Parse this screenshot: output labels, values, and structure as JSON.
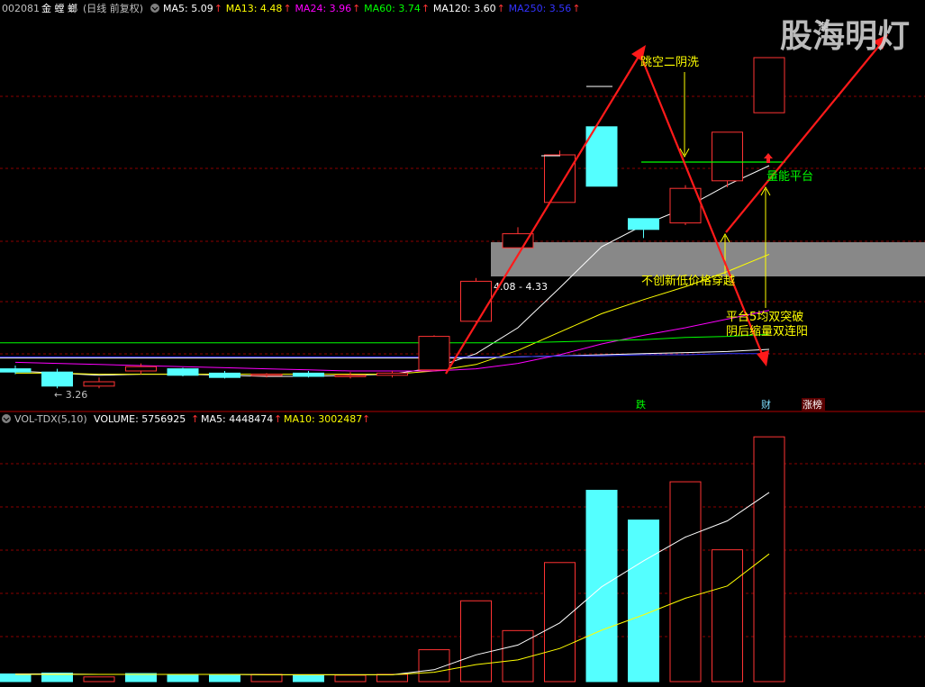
{
  "header": {
    "code": "002081",
    "name": "金 螳 螂",
    "period": "(日线 前复权)",
    "ma": [
      {
        "label": "MA5: 5.09",
        "color": "#ffffff"
      },
      {
        "label": "MA13: 4.48",
        "color": "#ffff00"
      },
      {
        "label": "MA24: 3.96",
        "color": "#ff00ff"
      },
      {
        "label": "MA60: 3.74",
        "color": "#00ff00"
      },
      {
        "label": "MA120: 3.60",
        "color": "#ffffff"
      },
      {
        "label": "MA250: 3.56",
        "color": "#3333ff"
      }
    ]
  },
  "vol_header": {
    "title": "VOL-TDX(5,10)",
    "volume": "VOLUME: 5756925",
    "ma5": "MA5: 4448474",
    "ma10": "MA10: 3002487"
  },
  "watermark": "股海明灯",
  "annotations": {
    "gap_wash": "跳空二阴洗",
    "volume_platform": "量能平台",
    "no_new_low": "不创新低价格穿越",
    "platform_break": "平台5均双突破",
    "shrink_double_yang": "阴后缩量双连阳",
    "price_low": "← 3.26",
    "band_range": "4.08 - 4.33",
    "tag_die": "跌",
    "tag_cai": "财",
    "tag_zhangbang": "涨榜",
    "top_label": "海"
  },
  "colors": {
    "background": "#000000",
    "up": "#ff3333",
    "down": "#54ffff",
    "grid": "#8b0000",
    "arrow": "#ff1a1a",
    "annotation": "#ffff00",
    "platform": "#00ff00"
  },
  "chart_data": [
    {
      "type": "candlestick",
      "title": "002081 金 螳 螂 (日线 前复权)",
      "ylim": [
        2.9,
        6.3
      ],
      "candles": [
        {
          "o": 3.42,
          "h": 3.45,
          "l": 3.37,
          "c": 3.39
        },
        {
          "o": 3.39,
          "h": 3.42,
          "l": 3.24,
          "c": 3.26
        },
        {
          "o": 3.26,
          "h": 3.34,
          "l": 3.24,
          "c": 3.3
        },
        {
          "o": 3.4,
          "h": 3.47,
          "l": 3.37,
          "c": 3.44
        },
        {
          "o": 3.42,
          "h": 3.43,
          "l": 3.35,
          "c": 3.36
        },
        {
          "o": 3.38,
          "h": 3.4,
          "l": 3.33,
          "c": 3.34
        },
        {
          "o": 3.36,
          "h": 3.38,
          "l": 3.34,
          "c": 3.37
        },
        {
          "o": 3.38,
          "h": 3.4,
          "l": 3.34,
          "c": 3.35
        },
        {
          "o": 3.35,
          "h": 3.39,
          "l": 3.33,
          "c": 3.36
        },
        {
          "o": 3.36,
          "h": 3.4,
          "l": 3.34,
          "c": 3.38
        },
        {
          "o": 3.41,
          "h": 3.73,
          "l": 3.4,
          "c": 3.72
        },
        {
          "o": 3.86,
          "h": 4.26,
          "l": 3.85,
          "c": 4.23
        },
        {
          "o": 4.54,
          "h": 4.73,
          "l": 4.54,
          "c": 4.67
        },
        {
          "o": 4.96,
          "h": 5.44,
          "l": 4.96,
          "c": 5.4
        },
        {
          "o": 5.66,
          "h": 5.66,
          "l": 5.11,
          "c": 5.11
        },
        {
          "o": 4.81,
          "h": 4.81,
          "l": 4.63,
          "c": 4.71
        },
        {
          "o": 4.77,
          "h": 5.12,
          "l": 4.75,
          "c": 5.09
        },
        {
          "o": 5.16,
          "h": 5.61,
          "l": 5.1,
          "c": 5.61
        },
        {
          "o": 5.79,
          "h": 6.3,
          "l": 5.79,
          "c": 6.3
        }
      ],
      "ma_series": [
        {
          "name": "MA5",
          "color": "#ffffff",
          "values": [
            3.4,
            3.38,
            3.36,
            3.37,
            3.37,
            3.36,
            3.35,
            3.35,
            3.36,
            3.37,
            3.43,
            3.56,
            3.8,
            4.17,
            4.55,
            4.75,
            4.91,
            5.12,
            5.3
          ]
        },
        {
          "name": "MA13",
          "color": "#ffff00",
          "values": [
            3.38,
            3.38,
            3.37,
            3.37,
            3.37,
            3.37,
            3.37,
            3.37,
            3.37,
            3.37,
            3.4,
            3.46,
            3.59,
            3.76,
            3.93,
            4.06,
            4.18,
            4.32,
            4.48
          ]
        },
        {
          "name": "MA24",
          "color": "#ff00ff",
          "values": [
            3.48,
            3.47,
            3.46,
            3.45,
            3.44,
            3.43,
            3.42,
            3.41,
            3.4,
            3.4,
            3.4,
            3.42,
            3.47,
            3.55,
            3.65,
            3.73,
            3.8,
            3.88,
            3.96
          ]
        },
        {
          "name": "MA60",
          "color": "#00ff00",
          "values": [
            3.66,
            3.66,
            3.66,
            3.66,
            3.66,
            3.66,
            3.66,
            3.66,
            3.66,
            3.66,
            3.66,
            3.66,
            3.66,
            3.67,
            3.68,
            3.69,
            3.71,
            3.72,
            3.74
          ]
        },
        {
          "name": "MA120",
          "color": "#ffffff",
          "values": [
            3.52,
            3.52,
            3.52,
            3.52,
            3.52,
            3.52,
            3.52,
            3.52,
            3.52,
            3.52,
            3.52,
            3.52,
            3.53,
            3.54,
            3.55,
            3.56,
            3.57,
            3.58,
            3.6
          ]
        },
        {
          "name": "MA250",
          "color": "#3333ff",
          "values": [
            3.53,
            3.53,
            3.53,
            3.53,
            3.53,
            3.53,
            3.53,
            3.53,
            3.53,
            3.53,
            3.53,
            3.53,
            3.53,
            3.54,
            3.54,
            3.55,
            3.55,
            3.56,
            3.56
          ]
        }
      ]
    },
    {
      "type": "bar",
      "title": "VOL-TDX(5,10)",
      "ylim": [
        0,
        6000000
      ],
      "values": [
        180000,
        200000,
        110000,
        190000,
        170000,
        160000,
        170000,
        160000,
        150000,
        170000,
        750000,
        1900000,
        1200000,
        2800000,
        4500000,
        3800000,
        4700000,
        3100000,
        5756925
      ],
      "colors": [
        "down",
        "down",
        "up",
        "down",
        "down",
        "down",
        "up",
        "down",
        "up",
        "up",
        "up",
        "up",
        "up",
        "up",
        "down",
        "down",
        "up",
        "up",
        "up"
      ],
      "ma_series": [
        {
          "name": "MA5",
          "color": "#ffffff",
          "values": [
            180000,
            180000,
            170000,
            170000,
            170000,
            170000,
            160000,
            160000,
            160000,
            160000,
            280000,
            630000,
            860000,
            1380000,
            2230000,
            2840000,
            3400000,
            3780000,
            4448474
          ]
        },
        {
          "name": "MA10",
          "color": "#ffff00",
          "values": [
            170000,
            170000,
            170000,
            170000,
            170000,
            170000,
            160000,
            160000,
            160000,
            160000,
            220000,
            400000,
            510000,
            780000,
            1210000,
            1570000,
            1960000,
            2250000,
            3002487
          ]
        }
      ]
    }
  ]
}
